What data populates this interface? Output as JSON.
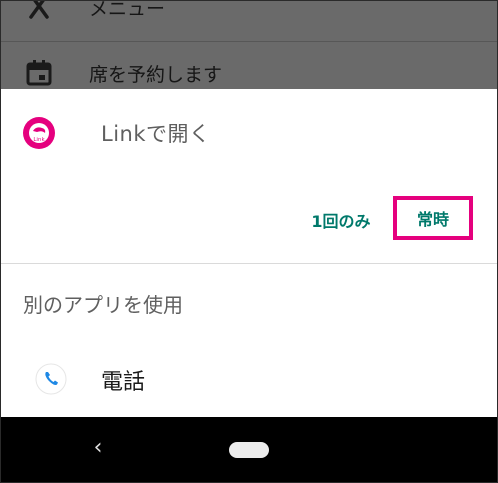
{
  "background_list": {
    "menu_label": "メニュー",
    "reserve_label": "席を予約します"
  },
  "sheet": {
    "open_with_title": "Linkで開く",
    "app_icon_text": "Link",
    "button_once": "1回のみ",
    "button_always": "常時",
    "other_apps_heading": "別のアプリを使用",
    "phone_app_label": "電話"
  },
  "nav_bar": {
    "back_glyph": "‹"
  },
  "colors": {
    "accent_teal": "#00796b",
    "highlight_pink": "#e5007e",
    "link_brand_pink": "#e5007e"
  }
}
